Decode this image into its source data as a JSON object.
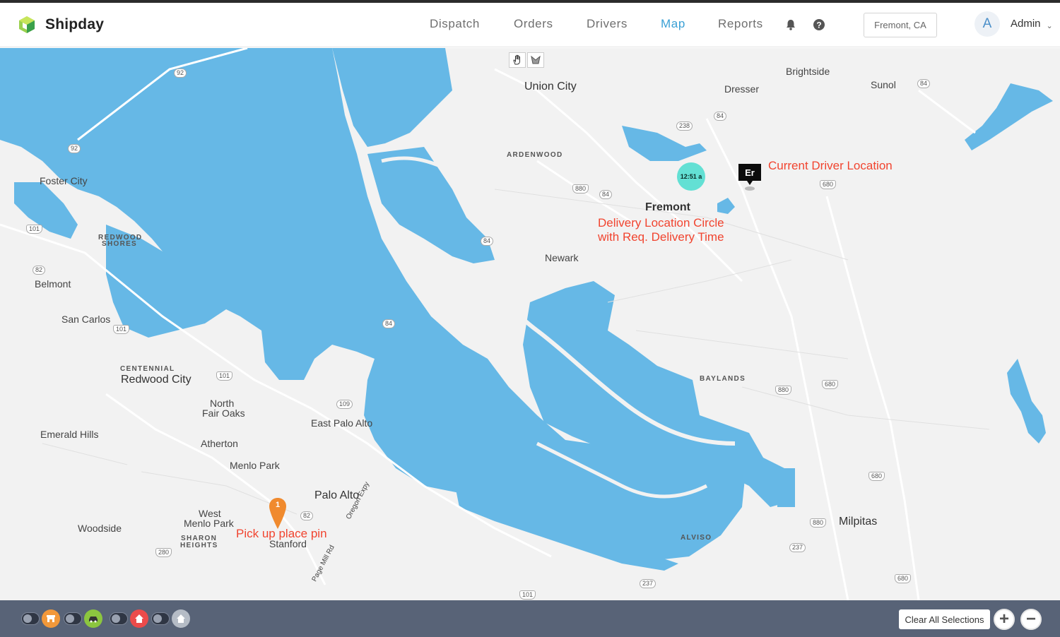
{
  "app": {
    "name": "Shipday"
  },
  "nav": {
    "items": [
      {
        "label": "Dispatch"
      },
      {
        "label": "Orders"
      },
      {
        "label": "Drivers"
      },
      {
        "label": "Map"
      },
      {
        "label": "Reports"
      }
    ],
    "active": "Map",
    "location": "Fremont, CA",
    "user_initial": "A",
    "user_name": "Admin"
  },
  "map": {
    "places": {
      "union_city": "Union City",
      "brightside": "Brightside",
      "dresser": "Dresser",
      "sunol": "Sunol",
      "ardenwood": "ARDENWOOD",
      "fremont": "Fremont",
      "newark": "Newark",
      "foster_city": "Foster City",
      "redwood_shores_1": "REDWOOD",
      "redwood_shores_2": "SHORES",
      "belmont": "Belmont",
      "san_carlos": "San Carlos",
      "centennial": "CENTENNIAL",
      "redwood_city": "Redwood City",
      "north_fair_oaks_1": "North",
      "north_fair_oaks_2": "Fair Oaks",
      "east_palo_alto": "East Palo Alto",
      "emerald_hills": "Emerald Hills",
      "atherton": "Atherton",
      "menlo_park": "Menlo Park",
      "palo_alto": "Palo Alto",
      "west_menlo_1": "West",
      "west_menlo_2": "Menlo Park",
      "woodside": "Woodside",
      "sharon_1": "SHARON",
      "sharon_2": "HEIGHTS",
      "stanford": "Stanford",
      "baylands": "BAYLANDS",
      "milpitas": "Milpitas",
      "alviso": "ALVISO",
      "oregon_expy": "Oregon Expy",
      "page_mill": "Page Mill Rd"
    },
    "highways": [
      "92",
      "92",
      "101",
      "82",
      "101",
      "101",
      "84",
      "84",
      "84",
      "84",
      "84",
      "238",
      "880",
      "680",
      "680",
      "880",
      "109",
      "82",
      "280",
      "880",
      "237",
      "237",
      "680",
      "680",
      "101"
    ],
    "annotations": {
      "driver": "Current Driver Location",
      "delivery_1": "Delivery Location Circle",
      "delivery_2": "with Req. Delivery Time",
      "pickup": "Pick up place pin"
    },
    "delivery_time": "12:51 a",
    "driver_initials": "Er",
    "pickup_number": "1",
    "tools": [
      "hand-tool",
      "draw-tool"
    ]
  },
  "bottombar": {
    "filters": [
      {
        "name": "restaurant",
        "color": "#f2983a"
      },
      {
        "name": "driver",
        "color": "#8cc63f"
      },
      {
        "name": "home",
        "color": "#ec4b4b"
      },
      {
        "name": "home-grey",
        "color": "#b5bcc6"
      }
    ],
    "clear_label": "Clear All Selections",
    "zoom_in": "+",
    "zoom_out": "−"
  },
  "colors": {
    "water": "#66b8e6",
    "accent": "#3aa0d5",
    "annotation": "#f1442f",
    "bottombar": "#586377"
  }
}
